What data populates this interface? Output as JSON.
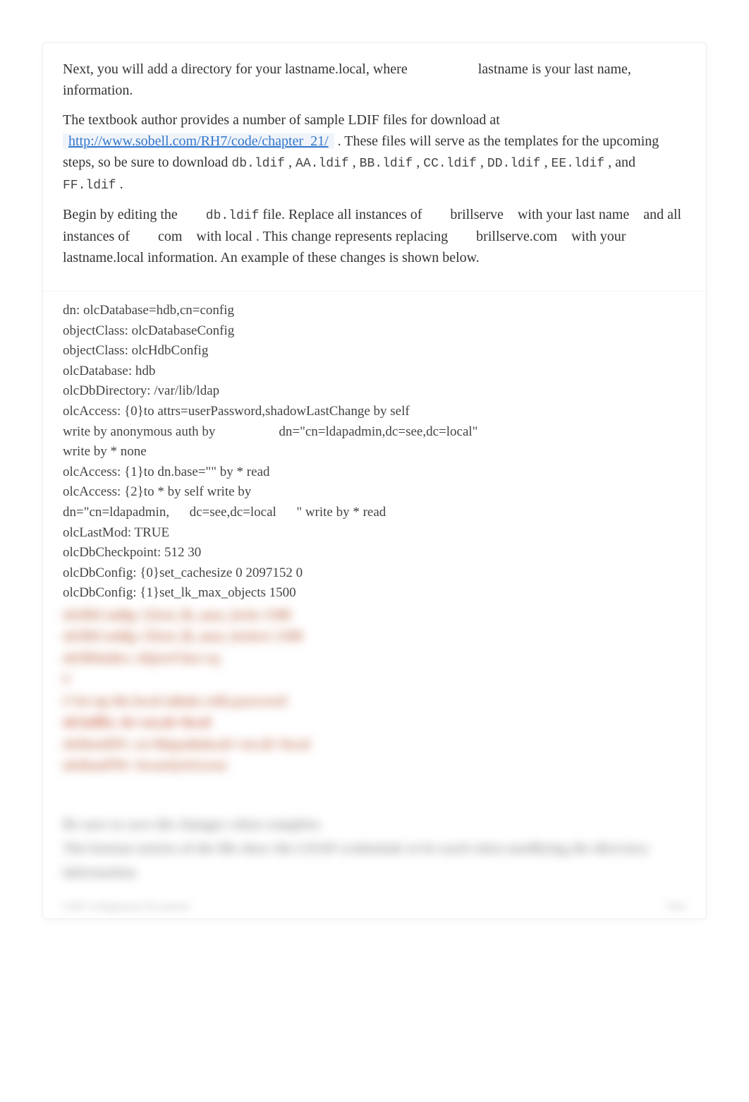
{
  "doc": {
    "para1": {
      "t1": "Next, you will add a directory for your lastname.local, where ",
      "t2": "lastname",
      "t3": " is your last name, information."
    },
    "para2": {
      "t1": "The textbook author provides a number of sample LDIF files for download at ",
      "url": "http://www.sobell.com/RH7/code/chapter_21/",
      "t2": " . These files will serve as the templates for the upcoming steps, so be sure to download ",
      "f1": "db.ldif",
      "c": " , ",
      "f2": "AA.ldif",
      "f3": "BB.ldif",
      "f4": "CC.ldif",
      "f5": "DD.ldif",
      "f6": "EE.ldif",
      "and": " , and ",
      "f7": "FF.ldif",
      "dot": " ."
    },
    "para3": {
      "t1": "Begin by editing the ",
      "file": "db.ldif",
      "t2": " file. Replace all instances of ",
      "v1": "brillserve",
      "t3": " with your ",
      "v2": "last name",
      "t4": " and all instances of ",
      "v3": "com",
      "t5": " with ",
      "v4": "local",
      "t6": " . This change represents replacing ",
      "v5": "brillserve.com",
      "t7": " with your ",
      "v6": "lastname.local",
      "t8": " information. An example of these changes is shown below."
    },
    "code": {
      "l1": "dn: olcDatabase=hdb,cn=config",
      "l2": "objectClass: olcDatabaseConfig",
      "l3": "objectClass: olcHdbConfig",
      "l4": "olcDatabase: hdb",
      "l5": "olcDbDirectory: /var/lib/ldap",
      "l6": "olcAccess: {0}to attrs=userPassword,shadowLastChange by self",
      "l7a": "write by anonymous auth by",
      "l7b": "dn=\"cn=ldapadmin,dc=see,dc=local\"",
      "l8": "write by * none",
      "l9": "olcAccess: {1}to dn.base=\"\" by * read",
      "l10": "olcAccess: {2}to * by self write by",
      "l11a": "dn=\"cn=ldapadmin,",
      "l11b": "dc=see,dc=local",
      "l11c": "\" write by * read",
      "l12": "olcLastMod: TRUE",
      "l13": "olcDbCheckpoint: 512 30",
      "l14": "olcDbConfig: {0}set_cachesize 0 2097152 0",
      "l15": "olcDbConfig: {1}set_lk_max_objects 1500",
      "blur1": "olcDbConfig: {2}set_lk_max_locks 1500",
      "blur2": "olcDbConfig: {3}set_lk_max_lockers 1500",
      "blur3": "olcDbIndex: objectClass eq",
      "blur4": "#",
      "blur5": "# Set up the local admin with password",
      "blur6": "olcSuffix: dc=see,dc=local",
      "blur7": "olcRootDN: cn=ldapadmin,dc=see,dc=local",
      "blur8": "olcRootPW: SecurityIsGreat"
    },
    "notes": {
      "n1": "Be sure to save the changes when complete.",
      "n2": "The bottom entries of the file show the LDAP credentials to be used when modifying the directory information."
    },
    "footer": {
      "left": "LDIF Configuration Documents",
      "right": "Next"
    }
  }
}
